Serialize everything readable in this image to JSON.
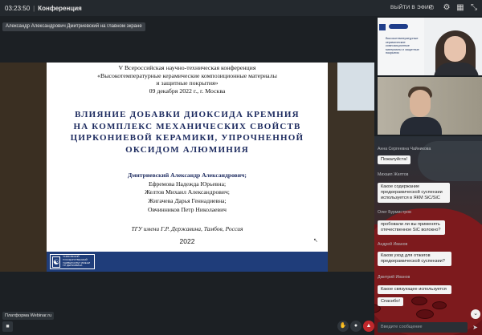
{
  "topbar": {
    "time": "03:23:50",
    "title": "Конференция",
    "exit_label": "ВЫЙТИ В ЭФИР"
  },
  "speaker_label": "Александр Александрович Дмитриевский на главном экране",
  "slide": {
    "heading_lines": [
      "V Всероссийская научно-техническая конференция",
      "«Высокотемпературные керамические композиционные материалы",
      "и защитные покрытия»",
      "09 декабря 2022 г., г. Москва"
    ],
    "title_lines": [
      "ВЛИЯНИЕ ДОБАВКИ ДИОКСИДА КРЕМНИЯ",
      "НА КОМПЛЕКС МЕХАНИЧЕСКИХ СВОЙСТВ",
      "ЦИРКОНИЕВОЙ КЕРАМИКИ, УПРОЧНЕННОЙ",
      "ОКСИДОМ АЛЮМИНИЯ"
    ],
    "lead_author": "Дмитриевский Александр Александрович;",
    "authors": [
      "Ефремова Надежда Юрьевна;",
      "Желтов Михаил Александрович;",
      "Жигачева Дарья Геннадиевна;",
      "Овчинников Петр Николаевич"
    ],
    "organization": "ТГУ имени Г.Р. Державина, Тамбов, Россия",
    "year": "2022",
    "footer_logo_text": "ТАМБОВСКИЙ ГОСУДАРСТВЕННЫЙ УНИВЕРСИТЕТ ИМЕНИ Г.Р. ДЕРЖАВИНА"
  },
  "participant_banner_text": "Высокотемпературные керамические композиционные материалы и защитные покрытия",
  "chat": {
    "messages": [
      {
        "author": "Анна Сергеевна Чайникова",
        "text": "Пожалуйста!"
      },
      {
        "author": "Михаил Желтов",
        "text": "Какое содержание предкерамической суспензии используется в ЯКМ SiC/SiC"
      },
      {
        "author": "Олег Бурмистров",
        "text": "пробовали ли вы применять отечественное SiC волокно?"
      },
      {
        "author": "Андрей Иванов",
        "text": "Каков уход для отжигов предкерамической суспензии?"
      },
      {
        "author": "Дмитрий Иванов",
        "text": "Какое связующее используется"
      },
      {
        "author": "",
        "text": "Спасибо!"
      }
    ],
    "input_placeholder": "Введите сообщение"
  },
  "bottom": {
    "platform_label": "Платформа Webinar.ru"
  },
  "colors": {
    "accent_blue": "#1e2c60",
    "control_red": "#c0282c"
  }
}
